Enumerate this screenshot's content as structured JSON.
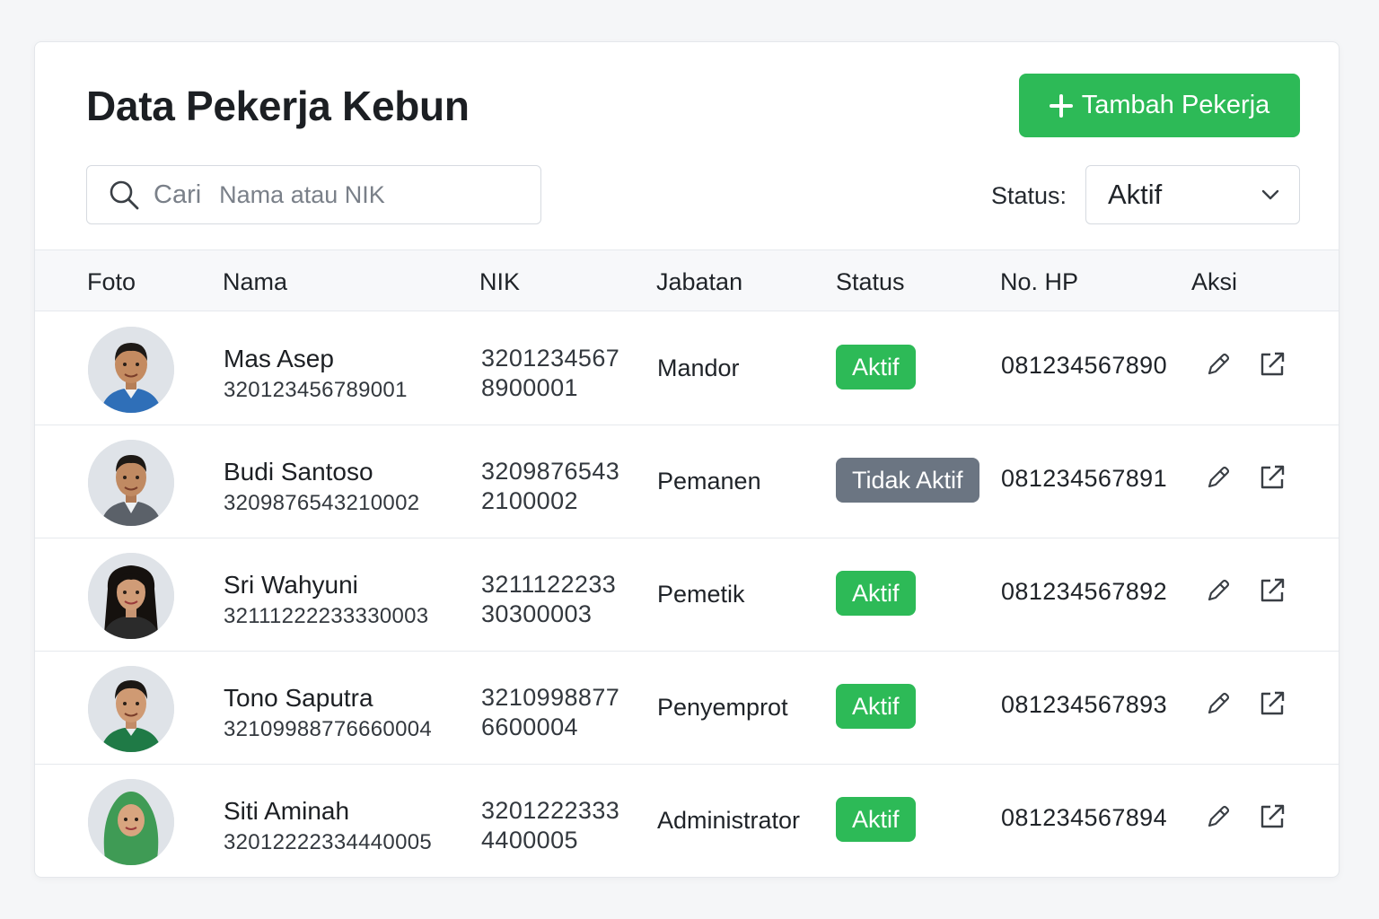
{
  "header": {
    "title": "Data Pekerja Kebun",
    "add_button_label": "Tambah Pekerja"
  },
  "search": {
    "label": "Cari",
    "placeholder": "Nama atau NIK"
  },
  "filter": {
    "label": "Status:",
    "selected": "Aktif"
  },
  "colors": {
    "accent_green": "#2dba57",
    "inactive_gray": "#6b7582"
  },
  "table": {
    "columns": [
      "Foto",
      "Nama",
      "NIK",
      "Jabatan",
      "Status",
      "No. HP",
      "Aksi"
    ],
    "rows": [
      {
        "name": "Mas Asep",
        "name_nik": "320123456789001",
        "nik": "32012345678900001",
        "jabatan": "Mandor",
        "status": "Aktif",
        "phone": "081234567890"
      },
      {
        "name": "Budi Santoso",
        "name_nik": "3209876543210002",
        "nik": "32098765432100002",
        "jabatan": "Pemanen",
        "status": "Tidak Aktif",
        "phone": "081234567891"
      },
      {
        "name": "Sri Wahyuni",
        "name_nik": "3211122223333​0003",
        "nik": "321112223330300003",
        "jabatan": "Pemetik",
        "status": "Aktif",
        "phone": "081234567892"
      },
      {
        "name": "Tono Saputra",
        "name_nik": "3210998877666​0004",
        "nik": "32109988776600004",
        "jabatan": "Penyemprot",
        "status": "Aktif",
        "phone": "081234567893"
      },
      {
        "name": "Siti Aminah",
        "name_nik": "3201222233444​0005",
        "nik": "32012223334400005",
        "jabatan": "Administrator",
        "status": "Aktif",
        "phone": "081234567894"
      }
    ]
  }
}
